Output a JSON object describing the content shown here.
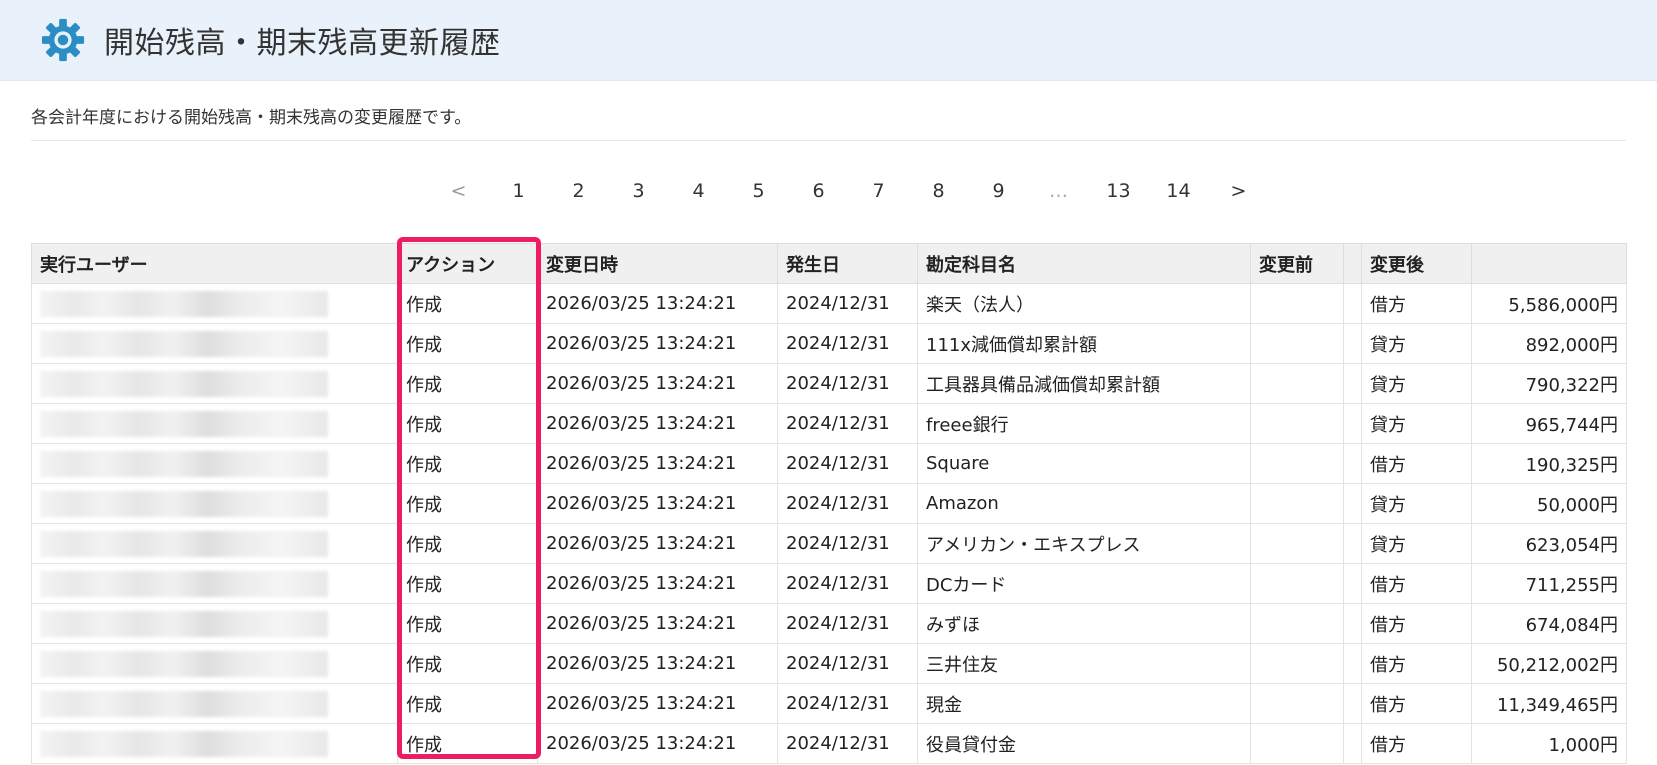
{
  "header": {
    "title": "開始残高・期末残高更新履歴",
    "icon": "gear-icon",
    "accent": "#2a8ec5"
  },
  "description": "各会計年度における開始残高・期末残高の変更履歴です。",
  "pagination": {
    "prev": "<",
    "pages": [
      "1",
      "2",
      "3",
      "4",
      "5",
      "6",
      "7",
      "8",
      "9",
      "…",
      "13",
      "14"
    ],
    "next": ">"
  },
  "table": {
    "headers": [
      "実行ユーザー",
      "アクション",
      "変更日時",
      "発生日",
      "勘定科目名",
      "変更前",
      "",
      "変更後",
      ""
    ],
    "rows": [
      {
        "action": "作成",
        "datetime": "2026/03/25 13:24:21",
        "date": "2024/12/31",
        "account": "楽天（法人）",
        "before": "",
        "before2": "",
        "side": "借方",
        "amount": "5,586,000円"
      },
      {
        "action": "作成",
        "datetime": "2026/03/25 13:24:21",
        "date": "2024/12/31",
        "account": "111x減価償却累計額",
        "before": "",
        "before2": "",
        "side": "貸方",
        "amount": "892,000円"
      },
      {
        "action": "作成",
        "datetime": "2026/03/25 13:24:21",
        "date": "2024/12/31",
        "account": "工具器具備品減価償却累計額",
        "before": "",
        "before2": "",
        "side": "貸方",
        "amount": "790,322円"
      },
      {
        "action": "作成",
        "datetime": "2026/03/25 13:24:21",
        "date": "2024/12/31",
        "account": "freee銀行",
        "before": "",
        "before2": "",
        "side": "貸方",
        "amount": "965,744円"
      },
      {
        "action": "作成",
        "datetime": "2026/03/25 13:24:21",
        "date": "2024/12/31",
        "account": "Square",
        "before": "",
        "before2": "",
        "side": "借方",
        "amount": "190,325円"
      },
      {
        "action": "作成",
        "datetime": "2026/03/25 13:24:21",
        "date": "2024/12/31",
        "account": "Amazon",
        "before": "",
        "before2": "",
        "side": "貸方",
        "amount": "50,000円"
      },
      {
        "action": "作成",
        "datetime": "2026/03/25 13:24:21",
        "date": "2024/12/31",
        "account": "アメリカン・エキスプレス",
        "before": "",
        "before2": "",
        "side": "貸方",
        "amount": "623,054円"
      },
      {
        "action": "作成",
        "datetime": "2026/03/25 13:24:21",
        "date": "2024/12/31",
        "account": "DCカード",
        "before": "",
        "before2": "",
        "side": "借方",
        "amount": "711,255円"
      },
      {
        "action": "作成",
        "datetime": "2026/03/25 13:24:21",
        "date": "2024/12/31",
        "account": "みずほ",
        "before": "",
        "before2": "",
        "side": "借方",
        "amount": "674,084円"
      },
      {
        "action": "作成",
        "datetime": "2026/03/25 13:24:21",
        "date": "2024/12/31",
        "account": "三井住友",
        "before": "",
        "before2": "",
        "side": "借方",
        "amount": "50,212,002円"
      },
      {
        "action": "作成",
        "datetime": "2026/03/25 13:24:21",
        "date": "2024/12/31",
        "account": "現金",
        "before": "",
        "before2": "",
        "side": "借方",
        "amount": "11,349,465円"
      },
      {
        "action": "作成",
        "datetime": "2026/03/25 13:24:21",
        "date": "2024/12/31",
        "account": "役員貸付金",
        "before": "",
        "before2": "",
        "side": "借方",
        "amount": "1,000円"
      }
    ]
  },
  "highlight_color": "#ee1c62"
}
